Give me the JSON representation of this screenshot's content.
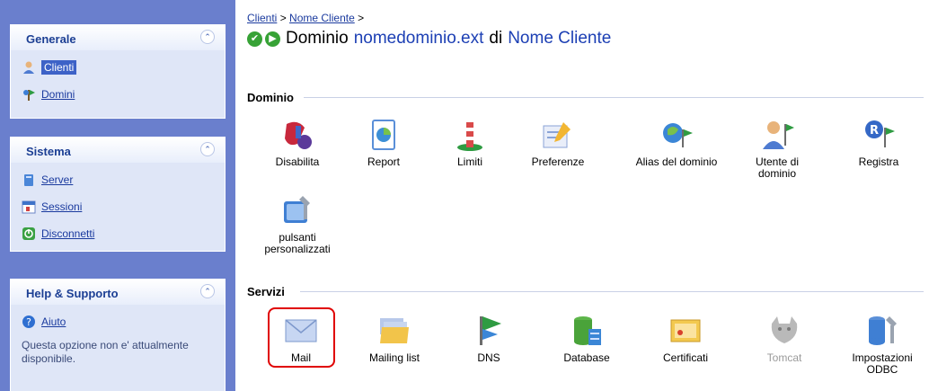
{
  "sidebar": {
    "generale": {
      "title": "Generale",
      "items": [
        {
          "label": "Clienti"
        },
        {
          "label": "Domini"
        }
      ]
    },
    "sistema": {
      "title": "Sistema",
      "items": [
        {
          "label": "Server"
        },
        {
          "label": "Sessioni"
        },
        {
          "label": "Disconnetti"
        }
      ]
    },
    "help": {
      "title": "Help & Supporto",
      "items": [
        {
          "label": "Aiuto"
        }
      ],
      "note": "Questa opzione non e' attualmente disponibile."
    },
    "collapse_glyph": "⌃"
  },
  "breadcrumb": {
    "link1": "Clienti",
    "sep1": " > ",
    "link2": "Nome Cliente",
    "sep2": " >"
  },
  "title": {
    "prefix": "Dominio",
    "domain": "nomedominio.ext",
    "middle": "di",
    "client": "Nome Cliente"
  },
  "sections": {
    "dominio": {
      "label": "Dominio",
      "tools": [
        {
          "label": "Disabilita"
        },
        {
          "label": "Report"
        },
        {
          "label": "Limiti"
        },
        {
          "label": "Preferenze"
        },
        {
          "label": "Alias del dominio"
        },
        {
          "label": "Utente di dominio"
        },
        {
          "label": "Registra"
        },
        {
          "label": "pulsanti personalizzati"
        }
      ]
    },
    "servizi": {
      "label": "Servizi",
      "tools": [
        {
          "label": "Mail"
        },
        {
          "label": "Mailing list"
        },
        {
          "label": "DNS"
        },
        {
          "label": "Database"
        },
        {
          "label": "Certificati"
        },
        {
          "label": "Tomcat"
        },
        {
          "label": "Impostazioni ODBC"
        }
      ]
    }
  },
  "colors": {
    "sidebar_bg": "#6a7fcd",
    "panel_bg": "#dfe6f7",
    "link": "#1a3a9e",
    "title_accent": "#1c3fb4",
    "highlight": "#e00000"
  }
}
